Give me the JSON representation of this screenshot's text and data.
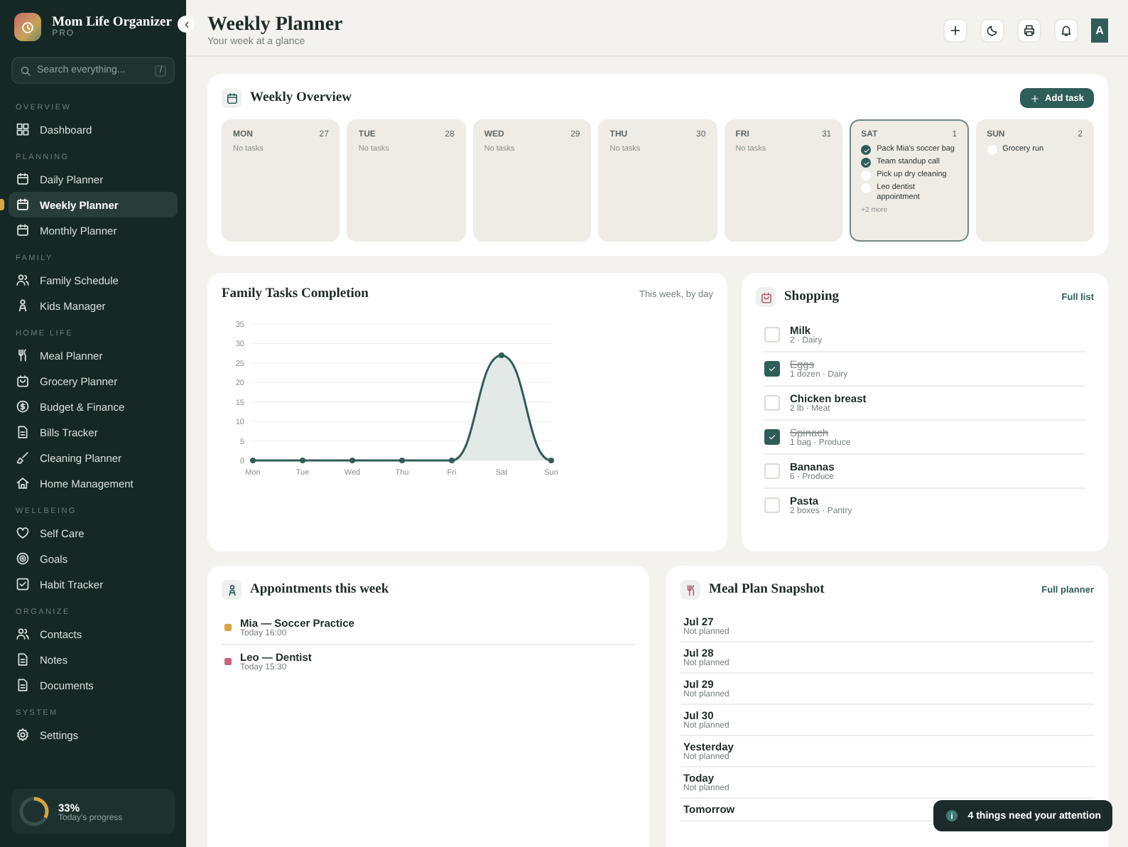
{
  "sidebar": {
    "app_name": "Mom Life Organizer",
    "plan": "PRO",
    "search": {
      "placeholder": "Search everything...",
      "shortcut": "/"
    },
    "sections": [
      {
        "label": "OVERVIEW",
        "items": [
          {
            "label": "Dashboard",
            "selected": false
          }
        ]
      },
      {
        "label": "PLANNING",
        "items": [
          {
            "label": "Daily Planner",
            "selected": false
          },
          {
            "label": "Weekly Planner",
            "selected": true
          },
          {
            "label": "Monthly Planner",
            "selected": false
          }
        ]
      },
      {
        "label": "FAMILY",
        "items": [
          {
            "label": "Family Schedule",
            "selected": false
          },
          {
            "label": "Kids Manager",
            "selected": false
          }
        ]
      },
      {
        "label": "HOME LIFE",
        "items": [
          {
            "label": "Meal Planner",
            "selected": false
          },
          {
            "label": "Grocery Planner",
            "selected": false
          },
          {
            "label": "Budget & Finance",
            "selected": false
          },
          {
            "label": "Bills Tracker",
            "selected": false
          },
          {
            "label": "Cleaning Planner",
            "selected": false
          },
          {
            "label": "Home Management",
            "selected": false
          }
        ]
      },
      {
        "label": "WELLBEING",
        "items": [
          {
            "label": "Self Care",
            "selected": false
          },
          {
            "label": "Goals",
            "selected": false
          },
          {
            "label": "Habit Tracker",
            "selected": false
          }
        ]
      },
      {
        "label": "ORGANIZE",
        "items": [
          {
            "label": "Contacts",
            "selected": false
          },
          {
            "label": "Notes",
            "selected": false
          },
          {
            "label": "Documents",
            "selected": false
          }
        ]
      },
      {
        "label": "SYSTEM",
        "items": [
          {
            "label": "Settings",
            "selected": false
          }
        ]
      }
    ],
    "progress": {
      "percent": "33%",
      "caption": "Today's progress",
      "level": 0.33
    }
  },
  "header": {
    "title": "Weekly Planner",
    "subtitle": "Your week at a glance",
    "avatar": "A"
  },
  "weekly_overview": {
    "title": "Weekly Overview",
    "add_button": "Add task",
    "days": [
      {
        "name": "MON",
        "date": "27",
        "selected": false,
        "empty_text": "No tasks"
      },
      {
        "name": "TUE",
        "date": "28",
        "selected": false,
        "empty_text": "No tasks"
      },
      {
        "name": "WED",
        "date": "29",
        "selected": false,
        "empty_text": "No tasks"
      },
      {
        "name": "THU",
        "date": "30",
        "selected": false,
        "empty_text": "No tasks"
      },
      {
        "name": "FRI",
        "date": "31",
        "selected": false,
        "empty_text": "No tasks"
      },
      {
        "name": "SAT",
        "date": "1",
        "selected": true,
        "more": "+2 more",
        "tasks": [
          {
            "label": "Pack Mia's soccer bag",
            "checked": true
          },
          {
            "label": "Team standup call",
            "checked": true
          },
          {
            "label": "Pick up dry cleaning",
            "checked": false
          },
          {
            "label": "Leo dentist appointment",
            "checked": false
          }
        ]
      },
      {
        "name": "SUN",
        "date": "2",
        "selected": false,
        "tasks": [
          {
            "label": "Grocery run",
            "checked": false
          }
        ]
      }
    ]
  },
  "completion": {
    "title": "Family Tasks Completion",
    "range": "This week, by day",
    "chart_data": {
      "type": "area",
      "categories": [
        "Mon",
        "Tue",
        "Wed",
        "Thu",
        "Fri",
        "Sat",
        "Sun"
      ],
      "series": [
        {
          "color": "#2f5d57",
          "values": [
            0,
            0,
            0,
            0,
            0,
            27,
            0
          ]
        }
      ],
      "grid": true,
      "ylim": [
        0,
        35
      ],
      "yticks": [
        0,
        5,
        10,
        15,
        20,
        25,
        30,
        35
      ]
    }
  },
  "shopping": {
    "title": "Shopping",
    "link": "Full list",
    "items": [
      {
        "name": "Milk",
        "detail": "2 · Dairy",
        "checked": false
      },
      {
        "name": "Eggs",
        "detail": "1 dozen · Dairy",
        "checked": true
      },
      {
        "name": "Chicken breast",
        "detail": "2 lb · Meat",
        "checked": false
      },
      {
        "name": "Spinach",
        "detail": "1 bag · Produce",
        "checked": true
      },
      {
        "name": "Bananas",
        "detail": "6 · Produce",
        "checked": false
      },
      {
        "name": "Pasta",
        "detail": "2 boxes · Pantry",
        "checked": false
      }
    ]
  },
  "appointments": {
    "title": "Appointments this week",
    "items": [
      {
        "title": "Mia — Soccer Practice",
        "time": "Today 16:00",
        "color": "#d9a441"
      },
      {
        "title": "Leo — Dentist",
        "time": "Today 15:30",
        "color": "#c9657a"
      }
    ]
  },
  "meal_plan": {
    "title": "Meal Plan Snapshot",
    "link": "Full planner",
    "days": [
      {
        "day": "Jul 27",
        "status": "Not planned"
      },
      {
        "day": "Jul 28",
        "status": "Not planned"
      },
      {
        "day": "Jul 29",
        "status": "Not planned"
      },
      {
        "day": "Jul 30",
        "status": "Not planned"
      },
      {
        "day": "Yesterday",
        "status": "Not planned"
      },
      {
        "day": "Today",
        "status": "Not planned"
      },
      {
        "day": "Tomorrow"
      }
    ]
  },
  "toast": {
    "message": "4 things need your attention"
  }
}
